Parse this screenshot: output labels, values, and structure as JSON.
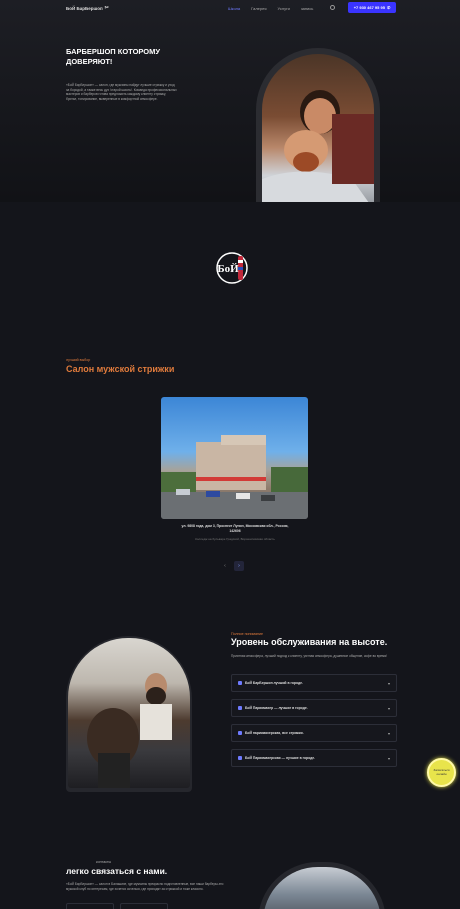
{
  "nav": {
    "logo": "БоЙ БарБершоп",
    "menu": [
      "Школа",
      "Галерея",
      "Услуги",
      "запись"
    ],
    "phone": "+7 930 467 95 95"
  },
  "hero": {
    "title": "БАРБЕРШОП КОТОРОМУ ДОВЕРЯЮТ!",
    "text": "«БоЙ БарБершоп» — салон, где мужчины найдут лучшие стрижку и уход за бородой, а также весь дух 'старой школы'. Команда профессиональных мастеров и барберов готова предложить каждому клиенту стрижку, бритье, тонирование, выверенные в комфортной атмосфере."
  },
  "salon": {
    "eyebrow": "лучший выбор",
    "title": "Салон мужской стрижки",
    "address": "ул. 9808 года, дом 3, Проспект Лунин, Московская обл., Россия, 142606",
    "note": "Колледж на бульваре Градской, Ворошиловская область",
    "prev": "‹",
    "next": "›"
  },
  "service": {
    "eyebrow": "Полное понимание",
    "title": "Уровень обслуживания на высоте.",
    "text": "Приятная атмосфера, лучший подход к клиенту, уютная атмосфера, душевное общение, кофе во время!",
    "items": [
      "БоЙ БарБершоп лучший в городе.",
      "БоЙ Парикмахер — лучшие в городе.",
      "БоЙ парикмахерская, все стрижки.",
      "БоЙ Парикмахерская — лучшие в городе."
    ]
  },
  "float_btn": "Записаться онлайн",
  "contact": {
    "eyebrow": "контакты",
    "title": "легко связаться с нами.",
    "text": "«БоЙ БарБершоп» — салон в Балашихе, где мужчины прекрасно подготовленные, все наши барберы-это мужской клуб по интересам, где хочется остаться, где приходят за стрижкой и тоже классно."
  },
  "colors": {
    "accent": "#3a34ff",
    "orange": "#e07b3c",
    "yellow": "#e8e44b"
  }
}
